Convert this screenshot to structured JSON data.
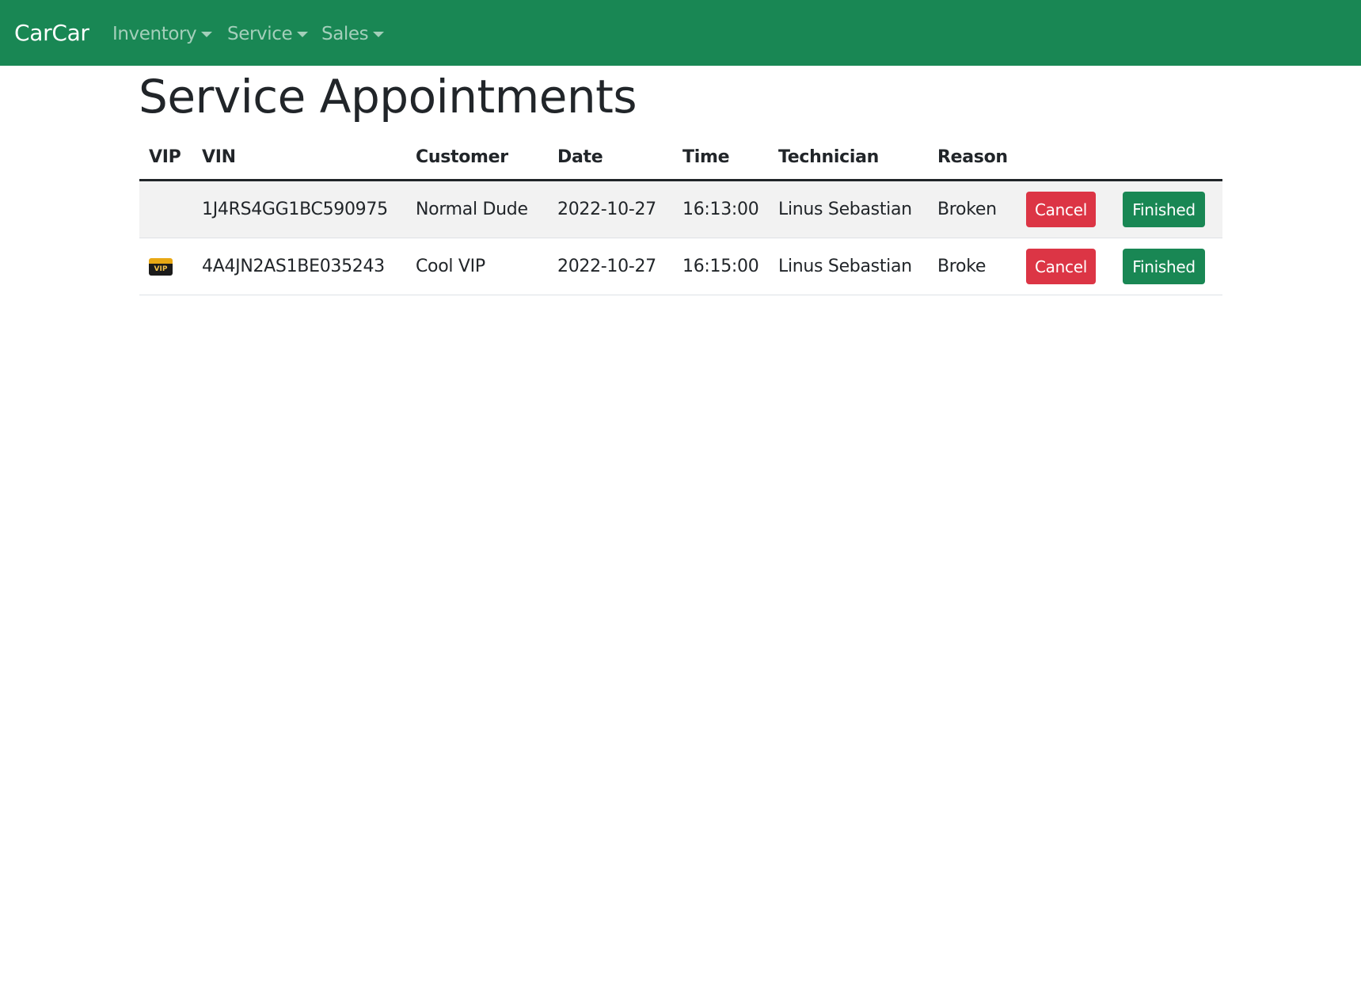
{
  "navbar": {
    "brand": "CarCar",
    "items": [
      {
        "label": "Inventory"
      },
      {
        "label": "Service"
      },
      {
        "label": "Sales"
      }
    ],
    "color": "#198754"
  },
  "page": {
    "title": "Service Appointments"
  },
  "table": {
    "headers": {
      "vip": "VIP",
      "vin": "VIN",
      "customer": "Customer",
      "date": "Date",
      "time": "Time",
      "technician": "Technician",
      "reason": "Reason"
    },
    "rows": [
      {
        "vip": false,
        "vin": "1J4RS4GG1BC590975",
        "customer": "Normal Dude",
        "date": "2022-10-27",
        "time": "16:13:00",
        "technician": "Linus Sebastian",
        "reason": "Broken",
        "cancel_label": "Cancel",
        "finished_label": "Finished"
      },
      {
        "vip": true,
        "vip_icon": "vip-icon",
        "vip_badge_text": "VIP",
        "vin": "4A4JN2AS1BE035243",
        "customer": "Cool VIP",
        "date": "2022-10-27",
        "time": "16:15:00",
        "technician": "Linus Sebastian",
        "reason": "Broke",
        "cancel_label": "Cancel",
        "finished_label": "Finished"
      }
    ]
  },
  "colors": {
    "cancel": "#dc3545",
    "finished": "#198754"
  }
}
